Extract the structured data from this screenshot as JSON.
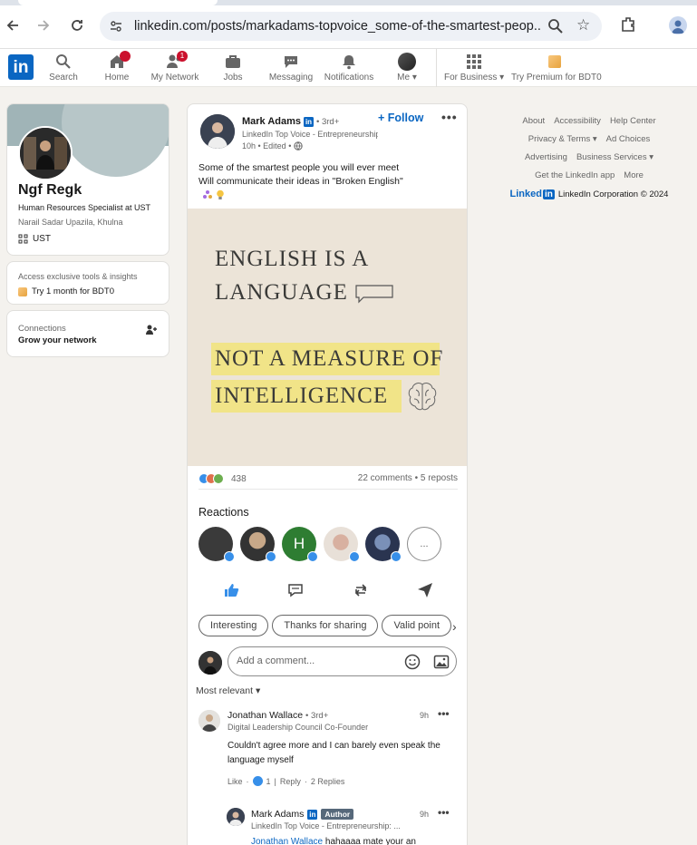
{
  "browser": {
    "url": "linkedin.com/posts/markadams-topvoice_some-of-the-smartest-peop..."
  },
  "nav": {
    "logo": "in",
    "items": [
      {
        "label": "Search",
        "icon": "search-icon"
      },
      {
        "label": "Home",
        "icon": "home-icon",
        "badge": ""
      },
      {
        "label": "My Network",
        "icon": "network-icon",
        "badge": "1"
      },
      {
        "label": "Jobs",
        "icon": "briefcase-icon"
      },
      {
        "label": "Messaging",
        "icon": "messaging-icon"
      },
      {
        "label": "Notifications",
        "icon": "bell-icon"
      },
      {
        "label": "Me",
        "icon": "avatar"
      },
      {
        "label": "For Business",
        "icon": "grid-icon"
      },
      {
        "label": "Try Premium for BDT0",
        "icon": "premium-icon"
      }
    ]
  },
  "profile": {
    "name": "Ngf Regk",
    "headline": "Human Resources Specialist at UST",
    "location": "Narail Sadar Upazila, Khulna",
    "org": "UST"
  },
  "premium": {
    "line1": "Access exclusive tools & insights",
    "line2": "Try 1 month for BDT0"
  },
  "connections": {
    "title": "Connections",
    "subtitle": "Grow your network"
  },
  "footer": {
    "links_row1": [
      "About",
      "Accessibility",
      "Help Center"
    ],
    "links_row2": [
      "Privacy & Terms",
      "Ad Choices"
    ],
    "links_row3": [
      "Advertising",
      "Business Services"
    ],
    "links_row4": [
      "Get the LinkedIn app",
      "More"
    ],
    "corp_brand": "Linked",
    "corp_brand_in": "in",
    "corp_text": "LinkedIn Corporation © 2024"
  },
  "post": {
    "author": "Mark Adams",
    "degree": "• 3rd+",
    "author_headline": "LinkedIn Top Voice - Entrepreneurship: ...",
    "time": "10h • Edited •",
    "follow": "+ Follow",
    "more": "•••",
    "text_line1": "Some of the smartest people you will ever meet",
    "text_line2": "Will communicate their ideas in \"Broken English\"",
    "image_line1": "ENGLISH IS A",
    "image_line2": "LANGUAGE",
    "image_line3": "NOT A MEASURE OF",
    "image_line4": "INTELLIGENCE",
    "reaction_count": "438",
    "comments_reposts": "22 comments • 5 reposts",
    "reactions_title": "Reactions",
    "reactor_initial": "H",
    "reactors_more": "...",
    "chips": [
      "Interesting",
      "Thanks for sharing",
      "Valid point"
    ],
    "comment_placeholder": "Add a comment...",
    "sort": "Most relevant"
  },
  "comments": [
    {
      "name": "Jonathan Wallace",
      "degree": "• 3rd+",
      "headline": "Digital Leadership Council Co-Founder",
      "time": "9h",
      "text": "Couldn't agree more and I can barely even speak the language myself",
      "like": "Like",
      "like_count": "1",
      "reply": "Reply",
      "replies": "2 Replies"
    },
    {
      "name": "Mark Adams",
      "tag": "Author",
      "headline": "LinkedIn Top Voice - Entrepreneurship: ...",
      "time": "9h",
      "mention": "Jonathan Wallace",
      "text": "hahaaaa mate your an"
    }
  ],
  "colors": {
    "linkedin_blue": "#0a66c2",
    "badge_red": "#cb112d",
    "highlight_yellow": "#f2e47a",
    "image_bg": "#ece4d8"
  }
}
